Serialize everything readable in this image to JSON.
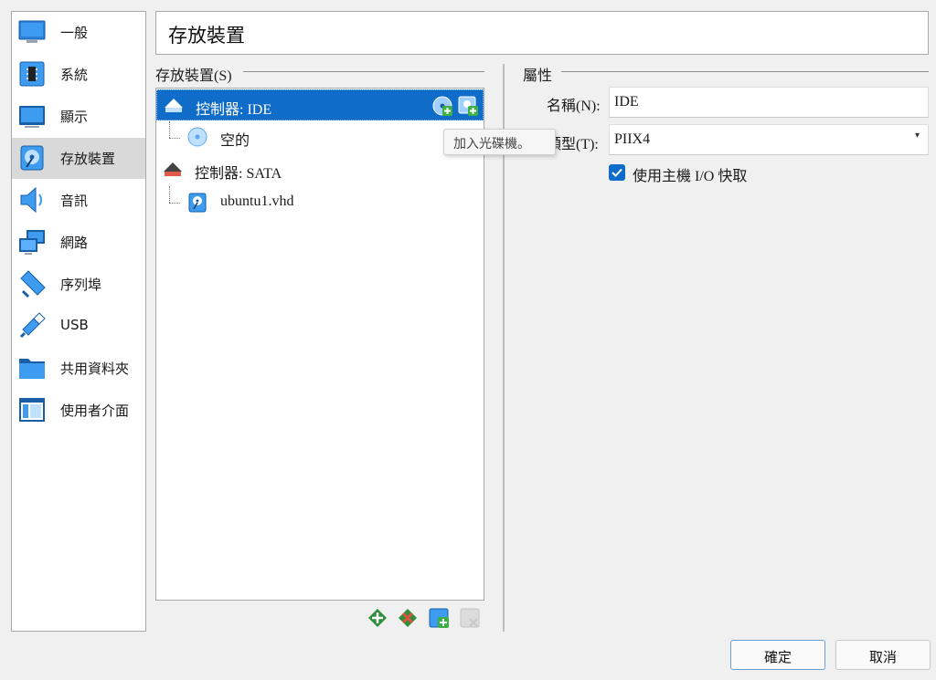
{
  "sidebar": {
    "items": [
      {
        "label": "一般",
        "icon": "general-monitor-icon"
      },
      {
        "label": "系統",
        "icon": "system-chip-icon"
      },
      {
        "label": "顯示",
        "icon": "display-monitor-icon"
      },
      {
        "label": "存放裝置",
        "icon": "storage-disk-icon",
        "selected": true
      },
      {
        "label": "音訊",
        "icon": "speaker-icon"
      },
      {
        "label": "網路",
        "icon": "network-icon"
      },
      {
        "label": "序列埠",
        "icon": "serial-port-icon"
      },
      {
        "label": "USB",
        "icon": "usb-icon"
      },
      {
        "label": "共用資料夾",
        "icon": "shared-folder-icon"
      },
      {
        "label": "使用者介面",
        "icon": "user-interface-icon"
      }
    ]
  },
  "page_title": "存放裝置",
  "storage": {
    "group_label": "存放裝置(S)",
    "tree": {
      "controller_ide": "控制器: IDE",
      "ide_child": "空的",
      "controller_sata": "控制器: SATA",
      "sata_child": "ubuntu1.vhd"
    },
    "tooltip": "加入光碟機。"
  },
  "properties": {
    "group_label": "屬性",
    "name_label": "名稱(N):",
    "name_value": "IDE",
    "type_label": "類型(T):",
    "type_value": "PIIX4",
    "host_io_cache_label": "使用主機 I/O 快取",
    "host_io_cache_checked": true
  },
  "buttons": {
    "ok": "確定",
    "cancel": "取消"
  },
  "colors": {
    "accent": "#0f6cc9",
    "selection_sidebar": "#d9d9d9"
  }
}
